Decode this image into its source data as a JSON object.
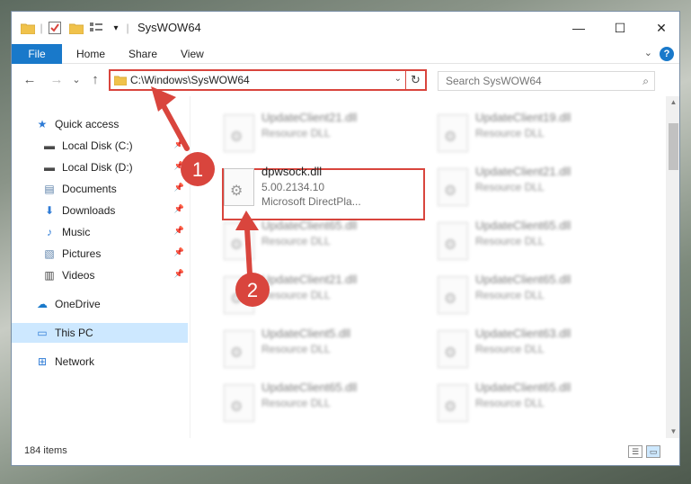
{
  "window": {
    "title": "SysWOW64"
  },
  "window_controls": {
    "minimize": "—",
    "maximize": "☐",
    "close": "✕"
  },
  "ribbon": {
    "tabs": [
      "File",
      "Home",
      "Share",
      "View"
    ],
    "help": "?",
    "expand": "⌄"
  },
  "nav": {
    "back": "←",
    "forward": "→",
    "recent": "⌄",
    "up": "↑",
    "address": "C:\\Windows\\SysWOW64",
    "address_dropdown": "⌄",
    "refresh": "↻",
    "search_placeholder": "Search SysWOW64",
    "search_icon": "⌕"
  },
  "sidebar": {
    "items": [
      {
        "label": "Quick access",
        "icon": "star-icon",
        "glyph": "★",
        "color": "#2e7bd6",
        "pinned": false
      },
      {
        "label": "Local Disk (C:)",
        "icon": "drive-icon",
        "glyph": "▬",
        "color": "#4a4a4a",
        "pinned": true
      },
      {
        "label": "Local Disk (D:)",
        "icon": "drive-icon",
        "glyph": "▬",
        "color": "#4a4a4a",
        "pinned": true
      },
      {
        "label": "Documents",
        "icon": "documents-icon",
        "glyph": "▤",
        "color": "#5a7fa8",
        "pinned": true
      },
      {
        "label": "Downloads",
        "icon": "download-icon",
        "glyph": "⬇",
        "color": "#2e7bd6",
        "pinned": true
      },
      {
        "label": "Music",
        "icon": "music-icon",
        "glyph": "♪",
        "color": "#2e7bd6",
        "pinned": true
      },
      {
        "label": "Pictures",
        "icon": "pictures-icon",
        "glyph": "▧",
        "color": "#5a7fa8",
        "pinned": true
      },
      {
        "label": "Videos",
        "icon": "video-icon",
        "glyph": "▥",
        "color": "#444444",
        "pinned": true
      },
      {
        "label": "OneDrive",
        "icon": "cloud-icon",
        "glyph": "☁",
        "color": "#1979ca",
        "pinned": false
      },
      {
        "label": "This PC",
        "icon": "computer-icon",
        "glyph": "▭",
        "color": "#2e7bd6",
        "pinned": false,
        "selected": true
      },
      {
        "label": "Network",
        "icon": "network-icon",
        "glyph": "⊞",
        "color": "#2e7bd6",
        "pinned": false
      }
    ],
    "pin_glyph": "📌"
  },
  "files": {
    "left": [
      {
        "name": "UpdateClient21.dll",
        "type": "Resource DLL",
        "blurred": true
      },
      {
        "name": "dpwsock.dll",
        "version": "5.00.2134.10",
        "desc": "Microsoft DirectPla...",
        "blurred": false,
        "highlighted": true
      },
      {
        "name": "UpdateClient65.dll",
        "type": "Resource DLL",
        "blurred": true
      },
      {
        "name": "UpdateClient21.dll",
        "type": "Resource DLL",
        "blurred": true
      },
      {
        "name": "UpdateClient5.dll",
        "type": "Resource DLL",
        "blurred": true
      },
      {
        "name": "UpdateClient65.dll",
        "type": "Resource DLL",
        "blurred": true
      }
    ],
    "right": [
      {
        "name": "UpdateClient19.dll",
        "type": "Resource DLL",
        "blurred": true
      },
      {
        "name": "UpdateClient21.dll",
        "type": "Resource DLL",
        "blurred": true
      },
      {
        "name": "UpdateClient65.dll",
        "type": "Resource DLL",
        "blurred": true
      },
      {
        "name": "UpdateClient65.dll",
        "type": "Resource DLL",
        "blurred": true
      },
      {
        "name": "UpdateClient63.dll",
        "type": "Resource DLL",
        "blurred": true
      },
      {
        "name": "UpdateClient65.dll",
        "type": "Resource DLL",
        "blurred": true
      }
    ],
    "file_icon": "gear-document-icon",
    "gear_glyph": "⚙"
  },
  "status": {
    "item_count": "184 items"
  },
  "annotations": {
    "step1": "1",
    "step2": "2",
    "color": "#d9453d"
  }
}
